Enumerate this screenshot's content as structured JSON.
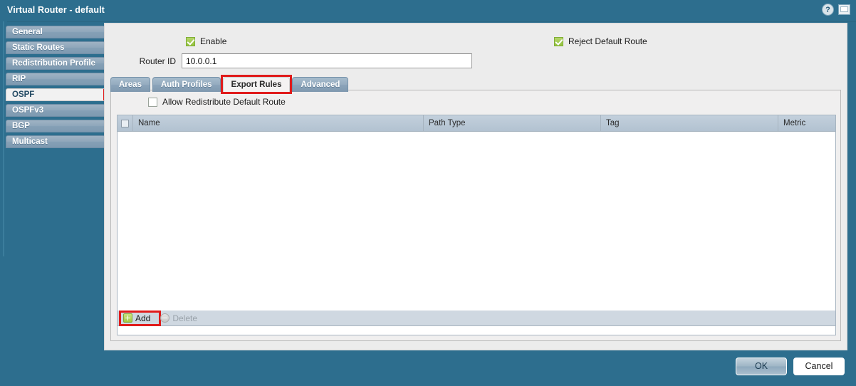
{
  "window": {
    "title": "Virtual Router - default",
    "help_icon": "help-circle-icon",
    "window_icon": "window-icon"
  },
  "sidebar": {
    "items": [
      {
        "label": "General",
        "selected": false
      },
      {
        "label": "Static Routes",
        "selected": false
      },
      {
        "label": "Redistribution Profile",
        "selected": false
      },
      {
        "label": "RIP",
        "selected": false
      },
      {
        "label": "OSPF",
        "selected": true
      },
      {
        "label": "OSPFv3",
        "selected": false
      },
      {
        "label": "BGP",
        "selected": false
      },
      {
        "label": "Multicast",
        "selected": false
      }
    ]
  },
  "form": {
    "enable_label": "Enable",
    "enable_checked": true,
    "reject_default_route_label": "Reject Default Route",
    "reject_default_route_checked": true,
    "router_id_label": "Router ID",
    "router_id_value": "10.0.0.1",
    "router_id_placeholder": ""
  },
  "tabs": [
    {
      "label": "Areas",
      "active": false
    },
    {
      "label": "Auth Profiles",
      "active": false
    },
    {
      "label": "Export Rules",
      "active": true
    },
    {
      "label": "Advanced",
      "active": false
    }
  ],
  "export_rules": {
    "allow_redistribute_label": "Allow Redistribute Default Route",
    "allow_redistribute_checked": false,
    "columns": [
      "Name",
      "Path Type",
      "Tag",
      "Metric"
    ],
    "rows": [],
    "toolbar": {
      "add_label": "Add",
      "add_icon": "plus-icon",
      "delete_label": "Delete",
      "delete_icon": "minus-icon",
      "delete_disabled": true
    }
  },
  "footer": {
    "ok_label": "OK",
    "cancel_label": "Cancel"
  },
  "colors": {
    "dialog_background": "#2d6e8e",
    "panel_background": "#ececec",
    "highlight_red": "#e01b1b",
    "checkbox_green": "#93c13e",
    "table_header": "#b2c2d1"
  }
}
